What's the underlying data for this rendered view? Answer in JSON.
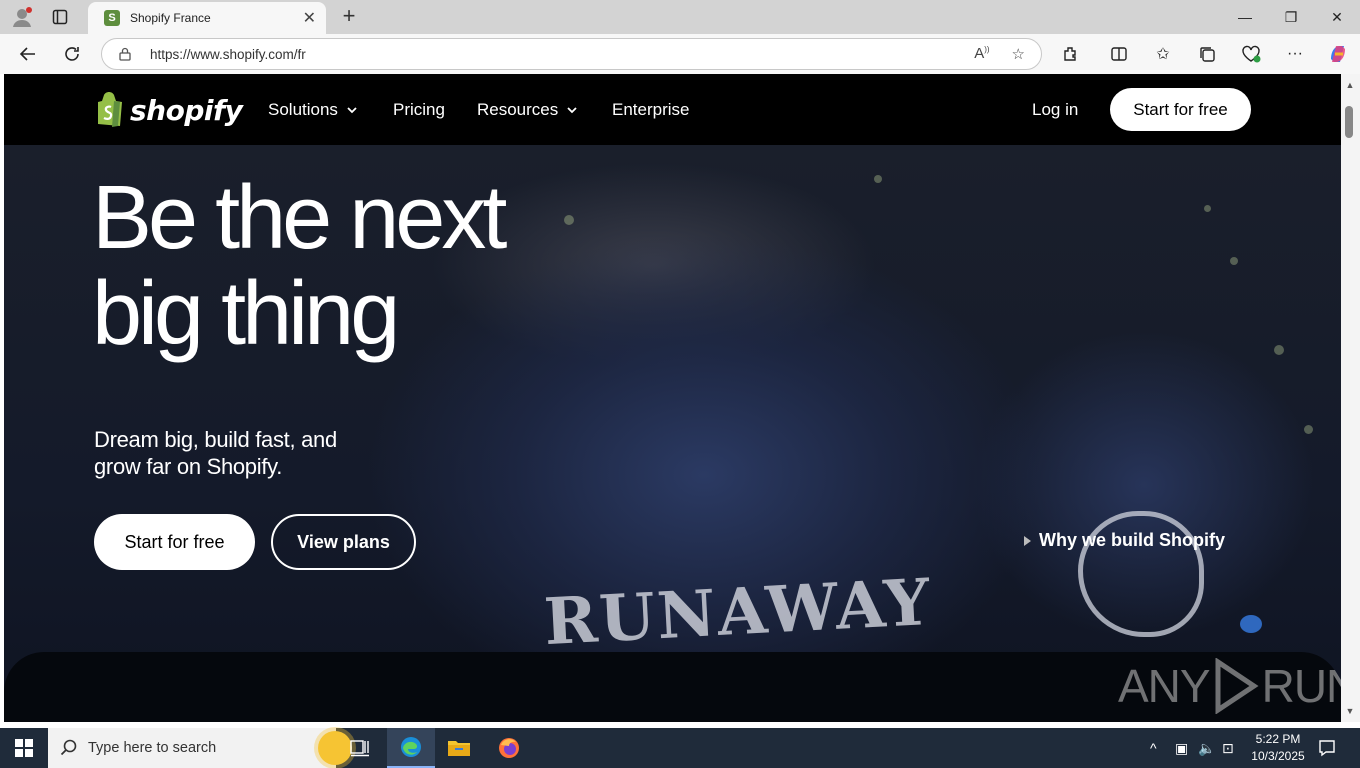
{
  "browser": {
    "tab_title": "Shopify France",
    "favicon_letter": "S",
    "url": "https://www.shopify.com/fr"
  },
  "site": {
    "logo_text": "shopify",
    "nav": {
      "solutions": "Solutions",
      "pricing": "Pricing",
      "resources": "Resources",
      "enterprise": "Enterprise",
      "login": "Log in",
      "cta": "Start for free"
    },
    "hero": {
      "headline_line1": "Be the next",
      "headline_line2": "big thing",
      "subhead": "Dream big, build fast, and grow far on Shopify.",
      "primary_button": "Start for free",
      "secondary_button": "View plans",
      "video_link": "Why we build Shopify",
      "shirt_text": "RUNAWAY"
    },
    "colors": {
      "brand_green": "#5e8e3e",
      "bg": "#000000"
    }
  },
  "watermark": {
    "left": "ANY",
    "right": "RUN"
  },
  "taskbar": {
    "search_placeholder": "Type here to search",
    "time": "5:22 PM",
    "date": "10/3/2025"
  }
}
